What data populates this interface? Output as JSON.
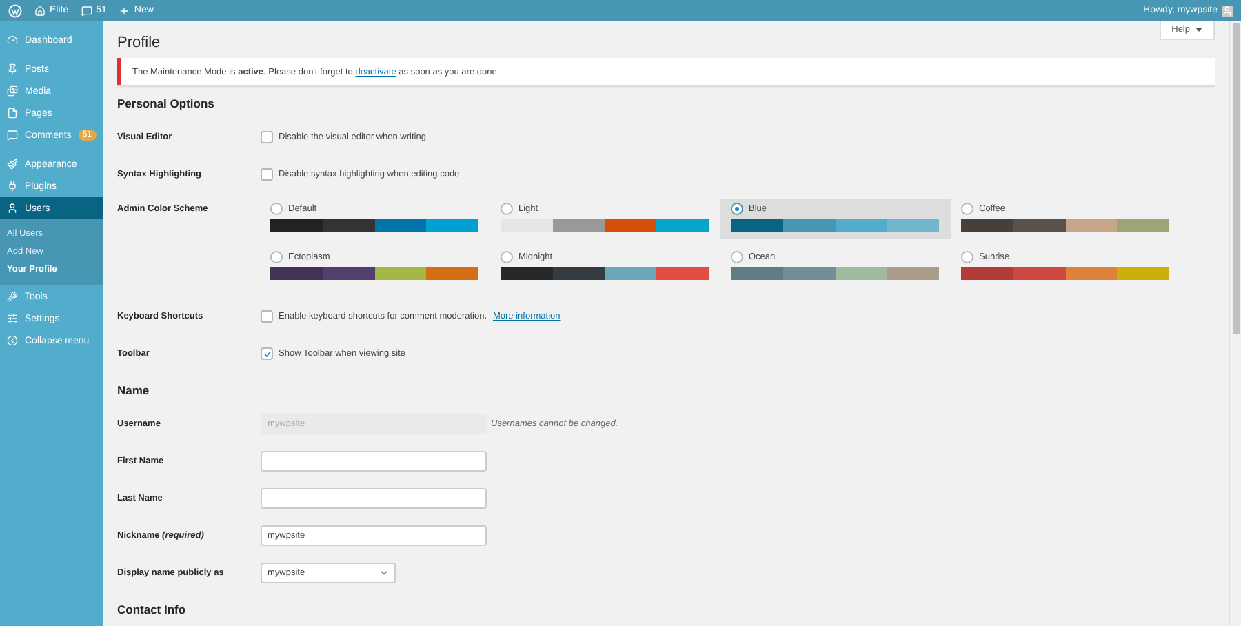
{
  "admin_bar": {
    "site": "Elite",
    "comments": "51",
    "new": "New",
    "greeting": "Howdy, mywpsite"
  },
  "menu_groups": [
    {
      "items": [
        {
          "label": "Dashboard",
          "kind": "dashboard",
          "selected": false
        }
      ]
    },
    {
      "items": [
        {
          "label": "Posts",
          "kind": "pin",
          "selected": false
        },
        {
          "label": "Media",
          "kind": "media",
          "selected": false
        },
        {
          "label": "Pages",
          "kind": "page",
          "selected": false
        },
        {
          "label": "Comments",
          "kind": "comment",
          "badge": "51",
          "selected": false
        }
      ]
    },
    {
      "items": [
        {
          "label": "Appearance",
          "kind": "brush",
          "selected": false
        },
        {
          "label": "Plugins",
          "kind": "plug",
          "selected": false
        },
        {
          "label": "Users",
          "kind": "user",
          "selected": true,
          "children": [
            {
              "label": "All Users",
              "selected": false
            },
            {
              "label": "Add New",
              "selected": false
            },
            {
              "label": "Your Profile",
              "selected": true
            }
          ]
        },
        {
          "label": "Tools",
          "kind": "wrench",
          "selected": false
        },
        {
          "label": "Settings",
          "kind": "settings",
          "selected": false
        },
        {
          "label": "Collapse menu",
          "kind": "collapse",
          "selected": false
        }
      ]
    }
  ],
  "help_button": "Help",
  "page_title": "Profile",
  "notice": {
    "before": "The Maintenance Mode is **active**. Please don't forget to",
    "link": "deactivate",
    "after": "as soon as you are done."
  },
  "sections": [
    {
      "heading": "Personal Options",
      "rows": [
        {
          "kind": "checkbox",
          "label": "Visual Editor",
          "text": "Disable the visual editor when writing",
          "checked": false
        },
        {
          "kind": "checkbox",
          "label": "Syntax Highlighting",
          "text": "Disable syntax highlighting when editing code",
          "checked": false
        },
        {
          "kind": "schemes",
          "label": "Admin Color Scheme",
          "schemes": [
            {
              "name": "Default",
              "selected": false,
              "swatches": [
                {
                  "color": "#222222"
                },
                {
                  "color": "#333333"
                },
                {
                  "color": "#0073aa"
                },
                {
                  "color": "#00a0d2"
                }
              ]
            },
            {
              "name": "Light",
              "selected": false,
              "swatches": [
                {
                  "color": "#e5e5e5"
                },
                {
                  "color": "#999999"
                },
                {
                  "color": "#d64e07"
                },
                {
                  "color": "#04a4cc"
                }
              ]
            },
            {
              "name": "Blue",
              "selected": true,
              "swatches": [
                {
                  "color": "#096484"
                },
                {
                  "color": "#4796b3"
                },
                {
                  "color": "#52accc"
                },
                {
                  "color": "#74b6ce"
                }
              ]
            },
            {
              "name": "Coffee",
              "selected": false,
              "swatches": [
                {
                  "color": "#46403c"
                },
                {
                  "color": "#59524c"
                },
                {
                  "color": "#c7a589"
                },
                {
                  "color": "#9ea476"
                }
              ]
            },
            {
              "name": "Ectoplasm",
              "selected": false,
              "swatches": [
                {
                  "color": "#413256"
                },
                {
                  "color": "#523f6d"
                },
                {
                  "color": "#a3b745"
                },
                {
                  "color": "#d46f15"
                }
              ]
            },
            {
              "name": "Midnight",
              "selected": false,
              "swatches": [
                {
                  "color": "#25282b"
                },
                {
                  "color": "#363b3f"
                },
                {
                  "color": "#69a8bb"
                },
                {
                  "color": "#e14d43"
                }
              ]
            },
            {
              "name": "Ocean",
              "selected": false,
              "swatches": [
                {
                  "color": "#627c83"
                },
                {
                  "color": "#738e96"
                },
                {
                  "color": "#9ebaa0"
                },
                {
                  "color": "#aa9d88"
                }
              ]
            },
            {
              "name": "Sunrise",
              "selected": false,
              "swatches": [
                {
                  "color": "#b43c38"
                },
                {
                  "color": "#cf4944"
                },
                {
                  "color": "#dd823b"
                },
                {
                  "color": "#ccaf0b"
                }
              ]
            }
          ]
        },
        {
          "kind": "checkbox",
          "label": "Keyboard Shortcuts",
          "text": "Enable keyboard shortcuts for comment moderation.",
          "link": "More information",
          "checked": false
        },
        {
          "kind": "checkbox",
          "label": "Toolbar",
          "text": "Show Toolbar when viewing site",
          "checked": true
        }
      ]
    },
    {
      "heading": "Name",
      "rows": [
        {
          "kind": "input",
          "label": "Username",
          "value": "mywpsite",
          "disabled": true,
          "note": "Usernames cannot be changed."
        },
        {
          "kind": "input",
          "label": "First Name",
          "disabled": false
        },
        {
          "kind": "input",
          "label": "Last Name",
          "disabled": false
        },
        {
          "kind": "input",
          "label": "Nickname *(required)*",
          "value": "mywpsite",
          "disabled": false
        },
        {
          "kind": "select",
          "label": "Display name publicly as",
          "value": "mywpsite"
        }
      ]
    },
    {
      "heading": "Contact Info"
    }
  ]
}
